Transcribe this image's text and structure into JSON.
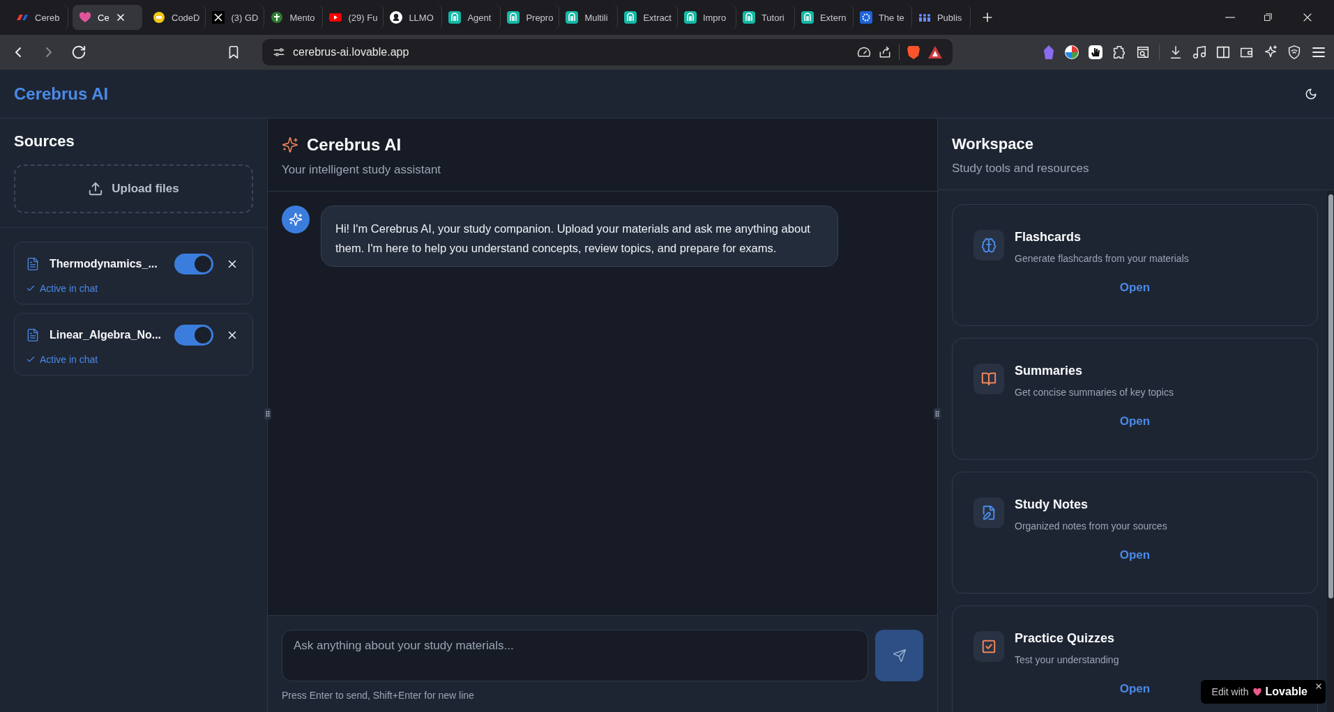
{
  "browser": {
    "tabs": [
      {
        "title": "Cereb",
        "selected": false
      },
      {
        "title": "Ce",
        "selected": true
      },
      {
        "title": "CodeD",
        "selected": false
      },
      {
        "title": "(3) GD",
        "selected": false
      },
      {
        "title": "Mento",
        "selected": false
      },
      {
        "title": "(29) Fu",
        "selected": false
      },
      {
        "title": "LLMO",
        "selected": false
      },
      {
        "title": "Agent",
        "selected": false
      },
      {
        "title": "Prepro",
        "selected": false
      },
      {
        "title": "Multili",
        "selected": false
      },
      {
        "title": "Extract",
        "selected": false
      },
      {
        "title": "Impro",
        "selected": false
      },
      {
        "title": "Tutori",
        "selected": false
      },
      {
        "title": "Extern",
        "selected": false
      },
      {
        "title": "The te",
        "selected": false
      },
      {
        "title": "Publis",
        "selected": false
      }
    ],
    "address": "cerebrus-ai.lovable.app"
  },
  "header": {
    "brand": "Cerebrus AI"
  },
  "sources": {
    "title": "Sources",
    "upload_label": "Upload files",
    "files": [
      {
        "name": "Thermodynamics_...",
        "on": true,
        "status": "Active in chat"
      },
      {
        "name": "Linear_Algebra_No...",
        "on": true,
        "status": "Active in chat"
      }
    ]
  },
  "chat": {
    "title": "Cerebrus AI",
    "subtitle": "Your intelligent study assistant",
    "messages": [
      {
        "kind": "assistant",
        "text": "Hi! I'm Cerebrus AI, your study companion. Upload your materials and ask me anything about them. I'm here to help you understand concepts, review topics, and prepare for exams."
      }
    ],
    "input": {
      "placeholder": "Ask anything about your study materials..."
    },
    "hint": "Press Enter to send, Shift+Enter for new line"
  },
  "workspace": {
    "title": "Workspace",
    "subtitle": "Study tools and resources",
    "tools": [
      {
        "title": "Flashcards",
        "description": "Generate flashcards from your materials",
        "action": "Open",
        "color": "#4a8ae8"
      },
      {
        "title": "Summaries",
        "description": "Get concise summaries of key topics",
        "action": "Open",
        "color": "#f0845a"
      },
      {
        "title": "Study Notes",
        "description": "Organized notes from your sources",
        "action": "Open",
        "color": "#4a8ae8"
      },
      {
        "title": "Practice Quizzes",
        "description": "Test your understanding",
        "action": "Open",
        "color": "#f0845a"
      }
    ]
  },
  "badge": {
    "text": "Edit with",
    "brand": "Lovable"
  }
}
